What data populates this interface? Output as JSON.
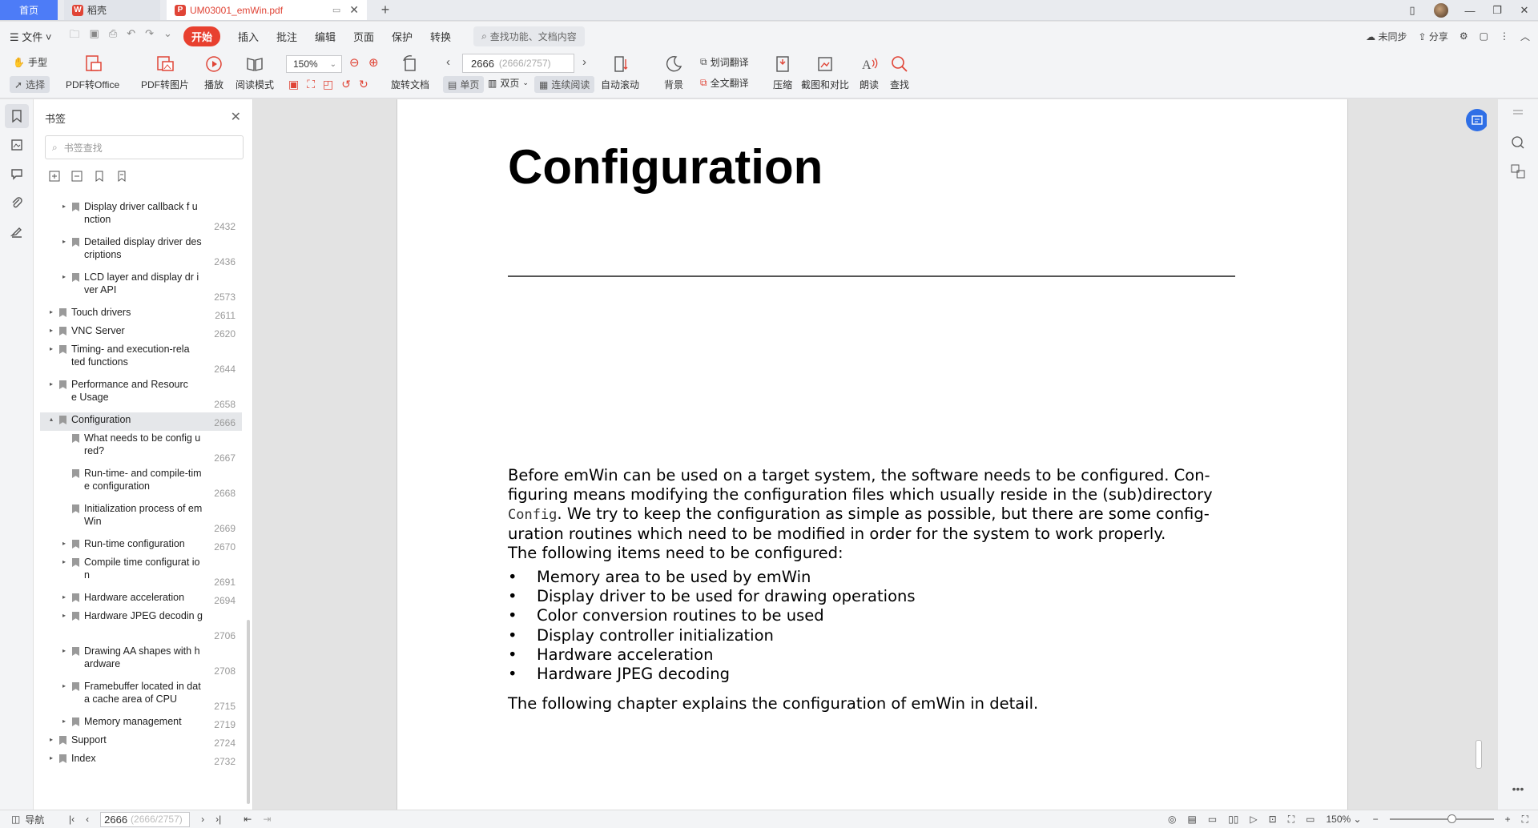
{
  "tabs": {
    "home": "首页",
    "wps": "稻壳",
    "doc": "UM03001_emWin.pdf"
  },
  "menu": {
    "file": "文件",
    "start": "开始",
    "items": [
      "插入",
      "批注",
      "编辑",
      "页面",
      "保护",
      "转换"
    ],
    "search_placeholder": "查找功能、文档内容",
    "sync": "未同步",
    "share": "分享"
  },
  "toolbar": {
    "hand": "手型",
    "select": "选择",
    "pdf_to_office": "PDF转Office",
    "pdf_to_image": "PDF转图片",
    "play": "播放",
    "read_mode": "阅读模式",
    "zoom": "150%",
    "rotate": "旋转文档",
    "page_current": "2666",
    "page_info": "(2666/2757)",
    "single": "单页",
    "double": "双页",
    "continuous": "连续阅读",
    "auto_scroll": "自动滚动",
    "background": "背景",
    "word_translate": "划词翻译",
    "full_translate": "全文翻译",
    "compress": "压缩",
    "screenshot_compare": "截图和对比",
    "read_aloud": "朗读",
    "find": "查找"
  },
  "panel": {
    "title": "书签",
    "search_placeholder": "书签查找",
    "items": [
      {
        "label": "Display driver callback f unction",
        "page": "2432",
        "level": 2,
        "toggle": "▸"
      },
      {
        "label": "Detailed display driver descriptions",
        "page": "2436",
        "level": 2,
        "toggle": "▸"
      },
      {
        "label": "LCD layer and display dr iver API",
        "page": "2573",
        "level": 2,
        "toggle": "▸"
      },
      {
        "label": "Touch drivers",
        "page": "2611",
        "level": 1,
        "toggle": "▸"
      },
      {
        "label": "VNC Server",
        "page": "2620",
        "level": 1,
        "toggle": "▸"
      },
      {
        "label": "Timing- and execution-rela ted functions",
        "page": "2644",
        "level": 1,
        "toggle": "▸"
      },
      {
        "label": "Performance and Resource Usage",
        "page": "2658",
        "level": 1,
        "toggle": "▸"
      },
      {
        "label": "Configuration",
        "page": "2666",
        "level": 1,
        "toggle": "▴",
        "selected": true
      },
      {
        "label": "What needs to be config ured?",
        "page": "2667",
        "level": 2,
        "toggle": ""
      },
      {
        "label": "Run-time- and compile-time configuration",
        "page": "2668",
        "level": 2,
        "toggle": ""
      },
      {
        "label": "Initialization process of emWin",
        "page": "2669",
        "level": 2,
        "toggle": ""
      },
      {
        "label": "Run-time configuration",
        "page": "2670",
        "level": 2,
        "toggle": "▸"
      },
      {
        "label": "Compile time configurat ion",
        "page": "2691",
        "level": 2,
        "toggle": "▸"
      },
      {
        "label": "Hardware acceleration",
        "page": "2694",
        "level": 2,
        "toggle": "▸"
      },
      {
        "label": "Hardware JPEG decodin g",
        "page": "2706",
        "level": 2,
        "toggle": "▸"
      },
      {
        "label": "Drawing AA shapes with hardware",
        "page": "2708",
        "level": 2,
        "toggle": "▸"
      },
      {
        "label": "Framebuffer located in data cache area of CPU",
        "page": "2715",
        "level": 2,
        "toggle": "▸"
      },
      {
        "label": "Memory management",
        "page": "2719",
        "level": 2,
        "toggle": "▸"
      },
      {
        "label": "Support",
        "page": "2724",
        "level": 1,
        "toggle": "▸"
      },
      {
        "label": "Index",
        "page": "2732",
        "level": 1,
        "toggle": "▸"
      }
    ]
  },
  "document": {
    "title": "Configuration",
    "para1_a": "Before emWin can be used on a target system, the software needs to be configured. Con-",
    "para1_b": "figuring means modifying the configuration files which usually reside in the (sub)directory",
    "para1_mono": "Config",
    "para1_c": ". We try to keep the configuration as simple as possible, but there are some config-",
    "para1_d": "uration routines which need to be modified in order for the system to work properly.",
    "para1_e": "The following items need to be configured:",
    "bullets": [
      "Memory area to be used by emWin",
      "Display driver to be used for drawing operations",
      "Color conversion routines to be used",
      "Display controller initialization",
      "Hardware acceleration",
      "Hardware JPEG decoding"
    ],
    "conclusion": "The following chapter explains the configuration of emWin in detail."
  },
  "statusbar": {
    "nav": "导航",
    "page_current": "2666",
    "page_info": "(2666/2757)",
    "zoom": "150%"
  }
}
